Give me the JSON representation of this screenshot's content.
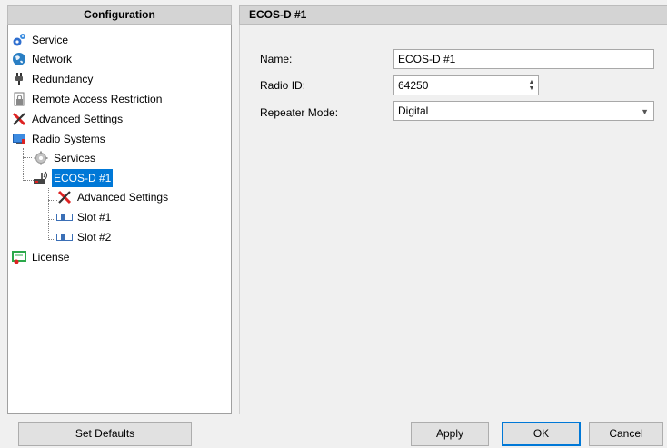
{
  "left_panel": {
    "title": "Configuration",
    "tree": {
      "service": "Service",
      "network": "Network",
      "redundancy": "Redundancy",
      "remote_access": "Remote Access Restriction",
      "advanced_settings": "Advanced Settings",
      "radio_systems": "Radio Systems",
      "services": "Services",
      "ecos_d": "ECOS-D #1",
      "ecos_advanced_settings": "Advanced Settings",
      "slot1": "Slot #1",
      "slot2": "Slot #2",
      "license": "License"
    },
    "selected": "ECOS-D #1"
  },
  "right_panel": {
    "title": "ECOS-D #1",
    "fields": {
      "name_label": "Name:",
      "name_value": "ECOS-D #1",
      "radio_id_label": "Radio ID:",
      "radio_id_value": "64250",
      "repeater_mode_label": "Repeater Mode:",
      "repeater_mode_value": "Digital"
    }
  },
  "buttons": {
    "set_defaults": "Set Defaults",
    "apply": "Apply",
    "ok": "OK",
    "cancel": "Cancel"
  },
  "colors": {
    "selection": "#0078d7",
    "header_bg": "#d4d4d4",
    "window_bg": "#f0f0f0"
  }
}
